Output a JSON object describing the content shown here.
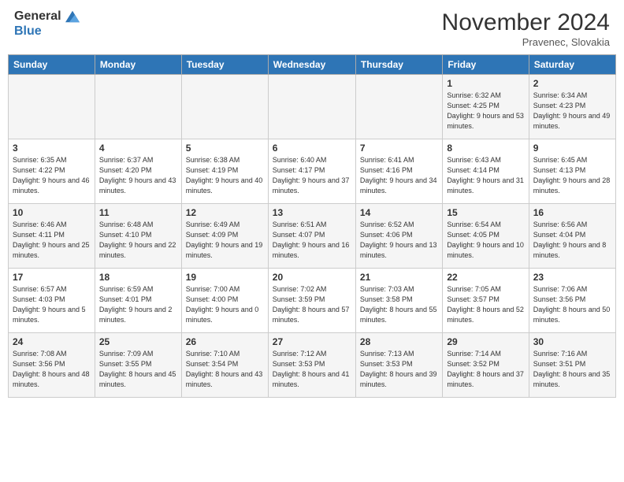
{
  "header": {
    "logo_line1": "General",
    "logo_line2": "Blue",
    "month": "November 2024",
    "location": "Pravenec, Slovakia"
  },
  "weekdays": [
    "Sunday",
    "Monday",
    "Tuesday",
    "Wednesday",
    "Thursday",
    "Friday",
    "Saturday"
  ],
  "weeks": [
    [
      {
        "day": "",
        "info": ""
      },
      {
        "day": "",
        "info": ""
      },
      {
        "day": "",
        "info": ""
      },
      {
        "day": "",
        "info": ""
      },
      {
        "day": "",
        "info": ""
      },
      {
        "day": "1",
        "info": "Sunrise: 6:32 AM\nSunset: 4:25 PM\nDaylight: 9 hours and 53 minutes."
      },
      {
        "day": "2",
        "info": "Sunrise: 6:34 AM\nSunset: 4:23 PM\nDaylight: 9 hours and 49 minutes."
      }
    ],
    [
      {
        "day": "3",
        "info": "Sunrise: 6:35 AM\nSunset: 4:22 PM\nDaylight: 9 hours and 46 minutes."
      },
      {
        "day": "4",
        "info": "Sunrise: 6:37 AM\nSunset: 4:20 PM\nDaylight: 9 hours and 43 minutes."
      },
      {
        "day": "5",
        "info": "Sunrise: 6:38 AM\nSunset: 4:19 PM\nDaylight: 9 hours and 40 minutes."
      },
      {
        "day": "6",
        "info": "Sunrise: 6:40 AM\nSunset: 4:17 PM\nDaylight: 9 hours and 37 minutes."
      },
      {
        "day": "7",
        "info": "Sunrise: 6:41 AM\nSunset: 4:16 PM\nDaylight: 9 hours and 34 minutes."
      },
      {
        "day": "8",
        "info": "Sunrise: 6:43 AM\nSunset: 4:14 PM\nDaylight: 9 hours and 31 minutes."
      },
      {
        "day": "9",
        "info": "Sunrise: 6:45 AM\nSunset: 4:13 PM\nDaylight: 9 hours and 28 minutes."
      }
    ],
    [
      {
        "day": "10",
        "info": "Sunrise: 6:46 AM\nSunset: 4:11 PM\nDaylight: 9 hours and 25 minutes."
      },
      {
        "day": "11",
        "info": "Sunrise: 6:48 AM\nSunset: 4:10 PM\nDaylight: 9 hours and 22 minutes."
      },
      {
        "day": "12",
        "info": "Sunrise: 6:49 AM\nSunset: 4:09 PM\nDaylight: 9 hours and 19 minutes."
      },
      {
        "day": "13",
        "info": "Sunrise: 6:51 AM\nSunset: 4:07 PM\nDaylight: 9 hours and 16 minutes."
      },
      {
        "day": "14",
        "info": "Sunrise: 6:52 AM\nSunset: 4:06 PM\nDaylight: 9 hours and 13 minutes."
      },
      {
        "day": "15",
        "info": "Sunrise: 6:54 AM\nSunset: 4:05 PM\nDaylight: 9 hours and 10 minutes."
      },
      {
        "day": "16",
        "info": "Sunrise: 6:56 AM\nSunset: 4:04 PM\nDaylight: 9 hours and 8 minutes."
      }
    ],
    [
      {
        "day": "17",
        "info": "Sunrise: 6:57 AM\nSunset: 4:03 PM\nDaylight: 9 hours and 5 minutes."
      },
      {
        "day": "18",
        "info": "Sunrise: 6:59 AM\nSunset: 4:01 PM\nDaylight: 9 hours and 2 minutes."
      },
      {
        "day": "19",
        "info": "Sunrise: 7:00 AM\nSunset: 4:00 PM\nDaylight: 9 hours and 0 minutes."
      },
      {
        "day": "20",
        "info": "Sunrise: 7:02 AM\nSunset: 3:59 PM\nDaylight: 8 hours and 57 minutes."
      },
      {
        "day": "21",
        "info": "Sunrise: 7:03 AM\nSunset: 3:58 PM\nDaylight: 8 hours and 55 minutes."
      },
      {
        "day": "22",
        "info": "Sunrise: 7:05 AM\nSunset: 3:57 PM\nDaylight: 8 hours and 52 minutes."
      },
      {
        "day": "23",
        "info": "Sunrise: 7:06 AM\nSunset: 3:56 PM\nDaylight: 8 hours and 50 minutes."
      }
    ],
    [
      {
        "day": "24",
        "info": "Sunrise: 7:08 AM\nSunset: 3:56 PM\nDaylight: 8 hours and 48 minutes."
      },
      {
        "day": "25",
        "info": "Sunrise: 7:09 AM\nSunset: 3:55 PM\nDaylight: 8 hours and 45 minutes."
      },
      {
        "day": "26",
        "info": "Sunrise: 7:10 AM\nSunset: 3:54 PM\nDaylight: 8 hours and 43 minutes."
      },
      {
        "day": "27",
        "info": "Sunrise: 7:12 AM\nSunset: 3:53 PM\nDaylight: 8 hours and 41 minutes."
      },
      {
        "day": "28",
        "info": "Sunrise: 7:13 AM\nSunset: 3:53 PM\nDaylight: 8 hours and 39 minutes."
      },
      {
        "day": "29",
        "info": "Sunrise: 7:14 AM\nSunset: 3:52 PM\nDaylight: 8 hours and 37 minutes."
      },
      {
        "day": "30",
        "info": "Sunrise: 7:16 AM\nSunset: 3:51 PM\nDaylight: 8 hours and 35 minutes."
      }
    ]
  ]
}
